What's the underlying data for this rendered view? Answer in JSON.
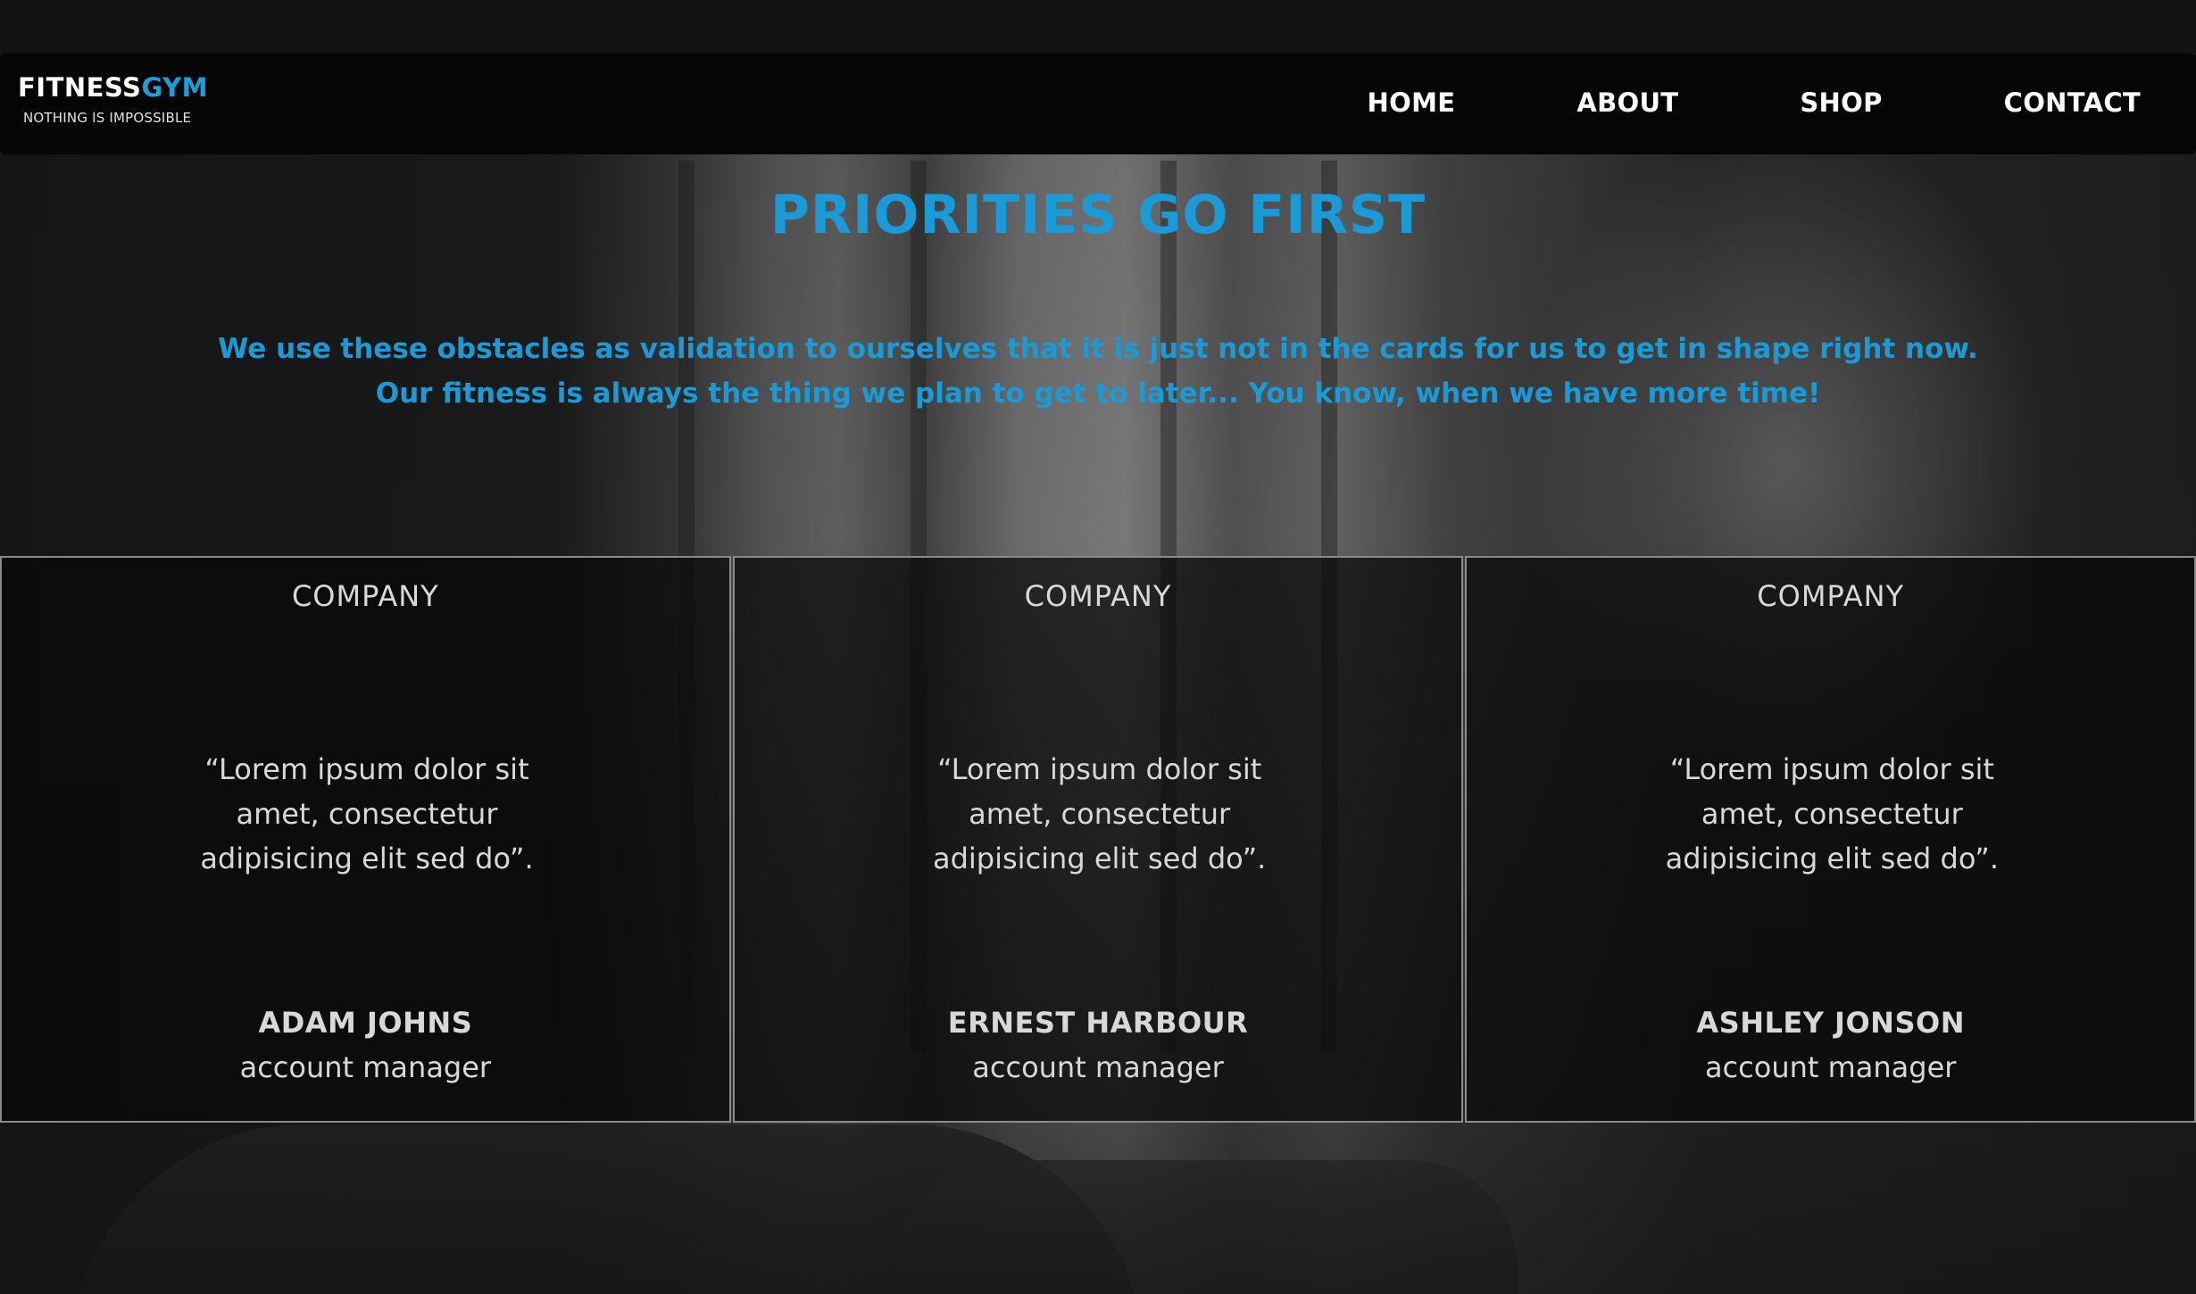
{
  "brand": {
    "name_primary": "FITNESS",
    "name_accent": "GYM",
    "tagline": "NOTHING IS IMPOSSIBLE",
    "accent_color": "#1aa0d8"
  },
  "nav": {
    "items": [
      {
        "label": "HOME"
      },
      {
        "label": "ABOUT"
      },
      {
        "label": "SHOP"
      },
      {
        "label": "CONTACT"
      }
    ]
  },
  "hero": {
    "title": "PRIORITIES GO FIRST",
    "text": "We use these obstacles as validation to ourselves that it is just not in the cards for us to get in shape right now. Our fitness is always the thing we plan to get to later... You know, when we have more time!",
    "text_color": "#1a9bd7"
  },
  "testimonials": [
    {
      "company": "COMPANY",
      "quote": "“Lorem ipsum dolor sit amet, consectetur adipisicing elit sed do”.",
      "name": "ADAM JOHNS",
      "role": "account manager"
    },
    {
      "company": "COMPANY",
      "quote": "“Lorem ipsum dolor sit amet, consectetur adipisicing elit sed do”.",
      "name": "ERNEST HARBOUR",
      "role": "account manager"
    },
    {
      "company": "COMPANY",
      "quote": "“Lorem ipsum dolor sit amet, consectetur adipisicing elit sed do”.",
      "name": "ASHLEY JONSON",
      "role": "account manager"
    }
  ]
}
